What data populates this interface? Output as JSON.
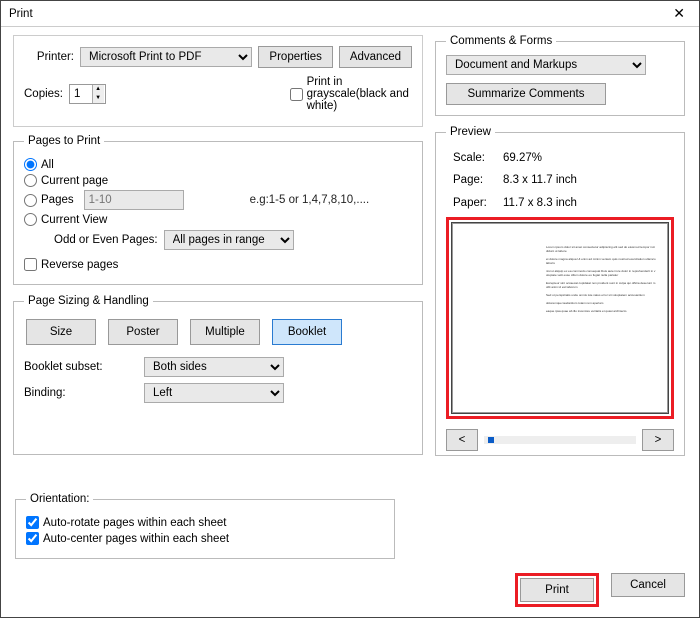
{
  "window": {
    "title": "Print"
  },
  "top": {
    "printer_label": "Printer:",
    "printer_value": "Microsoft Print to PDF",
    "properties": "Properties",
    "advanced": "Advanced",
    "copies_label": "Copies:",
    "copies_value": "1",
    "grayscale_label": "Print in grayscale(black and white)",
    "grayscale_checked": false
  },
  "pages": {
    "legend": "Pages to Print",
    "all": "All",
    "current": "Current page",
    "pages_label": "Pages",
    "pages_placeholder": "1-10",
    "pages_hint": "e.g:1-5 or 1,4,7,8,10,....",
    "current_view": "Current View",
    "odd_even_label": "Odd or Even Pages:",
    "odd_even_value": "All pages in range",
    "reverse": "Reverse pages",
    "selected": "all"
  },
  "sizing": {
    "legend": "Page Sizing & Handling",
    "tabs": {
      "size": "Size",
      "poster": "Poster",
      "multiple": "Multiple",
      "booklet": "Booklet"
    },
    "active_tab": "booklet",
    "subset_label": "Booklet subset:",
    "subset_value": "Both sides",
    "binding_label": "Binding:",
    "binding_value": "Left"
  },
  "comments": {
    "legend": "Comments & Forms",
    "value": "Document and Markups",
    "summarize": "Summarize Comments"
  },
  "preview": {
    "legend": "Preview",
    "scale_label": "Scale:",
    "scale_value": "69.27%",
    "page_label": "Page:",
    "page_value": "8.3 x 11.7 inch",
    "paper_label": "Paper:",
    "paper_value": "11.7 x 8.3 inch",
    "prev": "<",
    "next": ">"
  },
  "orientation": {
    "legend": "Orientation:",
    "auto_rotate": "Auto-rotate pages within each sheet",
    "auto_center": "Auto-center pages within each sheet"
  },
  "footer": {
    "print": "Print",
    "cancel": "Cancel"
  }
}
